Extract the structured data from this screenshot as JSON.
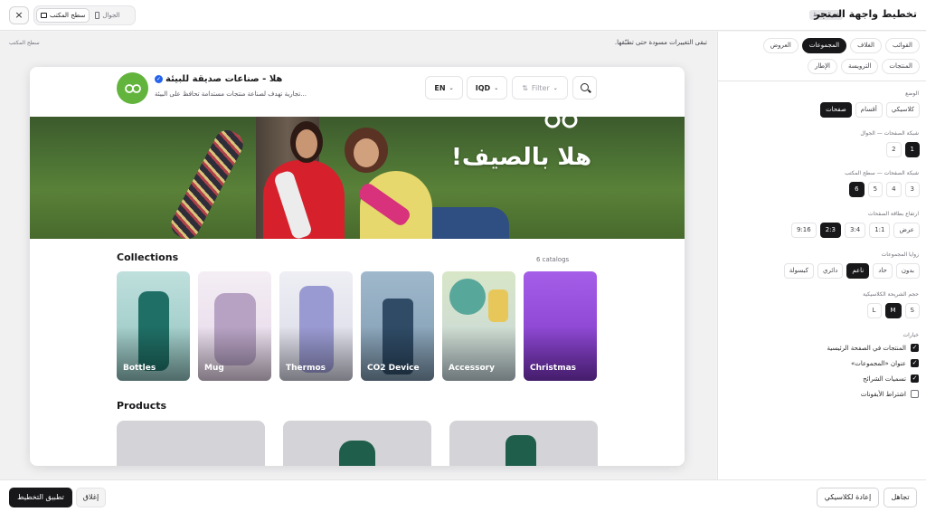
{
  "topbar": {
    "title": "تخطيط واجهة المتجر",
    "unsaved_badge": "غير محفوظ",
    "device_desktop": "سطح المكتب",
    "device_mobile": "الجوال",
    "close_icon": "×"
  },
  "canvas": {
    "note_left": "سطح المكتب",
    "note_right": "تبقى التغييرات مسودة حتى تطبّقها."
  },
  "store": {
    "name": "هلا - صناعات صديقة للبيئة",
    "verified_icon": "✓",
    "tagline": "تجارية تهدف لصناعة منتجات مستدامة تحافظ على البيئة...",
    "search_icon": "search-icon",
    "filter_label": "Filter",
    "filter_icon": "⇅",
    "currency": "IQD",
    "language": "EN",
    "chevron": "⌄",
    "brand_color": "#63b43d"
  },
  "hero": {
    "headline": "هلا بالصيف!"
  },
  "collections": {
    "title": "Collections",
    "count": "6 catalogs",
    "items": [
      {
        "label": "Bottles"
      },
      {
        "label": "Mug"
      },
      {
        "label": "Thermos"
      },
      {
        "label": "CO2 Device"
      },
      {
        "label": "Accessory"
      },
      {
        "label": "Christmas"
      }
    ]
  },
  "products": {
    "title": "Products"
  },
  "panel": {
    "tabs_row1": [
      {
        "label": "القوائب",
        "active": false
      },
      {
        "label": "الغلاف",
        "active": false
      },
      {
        "label": "المجموعات",
        "active": true
      },
      {
        "label": "العروض",
        "active": false
      }
    ],
    "tabs_row2": [
      {
        "label": "المنتجات",
        "active": false
      },
      {
        "label": "الترويسة",
        "active": false
      },
      {
        "label": "الإطار",
        "active": false
      }
    ],
    "mode": {
      "label": "الوضع",
      "options": [
        "كلاسيكي",
        "أقسام",
        "صفحات"
      ],
      "selected": "صفحات"
    },
    "grid_mobile": {
      "label": "شبكة الصفحات — الجوال",
      "options": [
        "1",
        "2"
      ],
      "selected": "1"
    },
    "grid_desktop": {
      "label": "شبكة الصفحات — سطح المكتب",
      "options": [
        "3",
        "4",
        "5",
        "6"
      ],
      "selected": "6"
    },
    "card_ratio": {
      "label": "ارتفاع بطاقة الصفحات",
      "options": [
        "عرض",
        "1:1",
        "3:4",
        "2:3",
        "9:16"
      ],
      "selected": "2:3"
    },
    "corners": {
      "label": "زوايا المجموعات",
      "options": [
        "بدون",
        "حاد",
        "ناعم",
        "دائري",
        "كبسولة"
      ],
      "selected": "ناعم"
    },
    "strip_size": {
      "label": "حجم الشريحة الكلاسيكية",
      "options": [
        "S",
        "M",
        "L"
      ],
      "selected": "M"
    },
    "options": {
      "label": "خيارات",
      "items": [
        {
          "label": "المنتجات في الصفحة الرئيسية",
          "checked": true
        },
        {
          "label": "عنوان «المجموعات»",
          "checked": true
        },
        {
          "label": "تسميات الشرائح",
          "checked": true
        },
        {
          "label": "اشتراط الأيقونات",
          "checked": false
        }
      ],
      "check_glyph": "✓"
    }
  },
  "bottombar": {
    "ignore": "تجاهل",
    "reset_classic": "إعادة لكلاسيكي",
    "close": "إغلاق",
    "apply": "تطبيق التخطيط"
  }
}
